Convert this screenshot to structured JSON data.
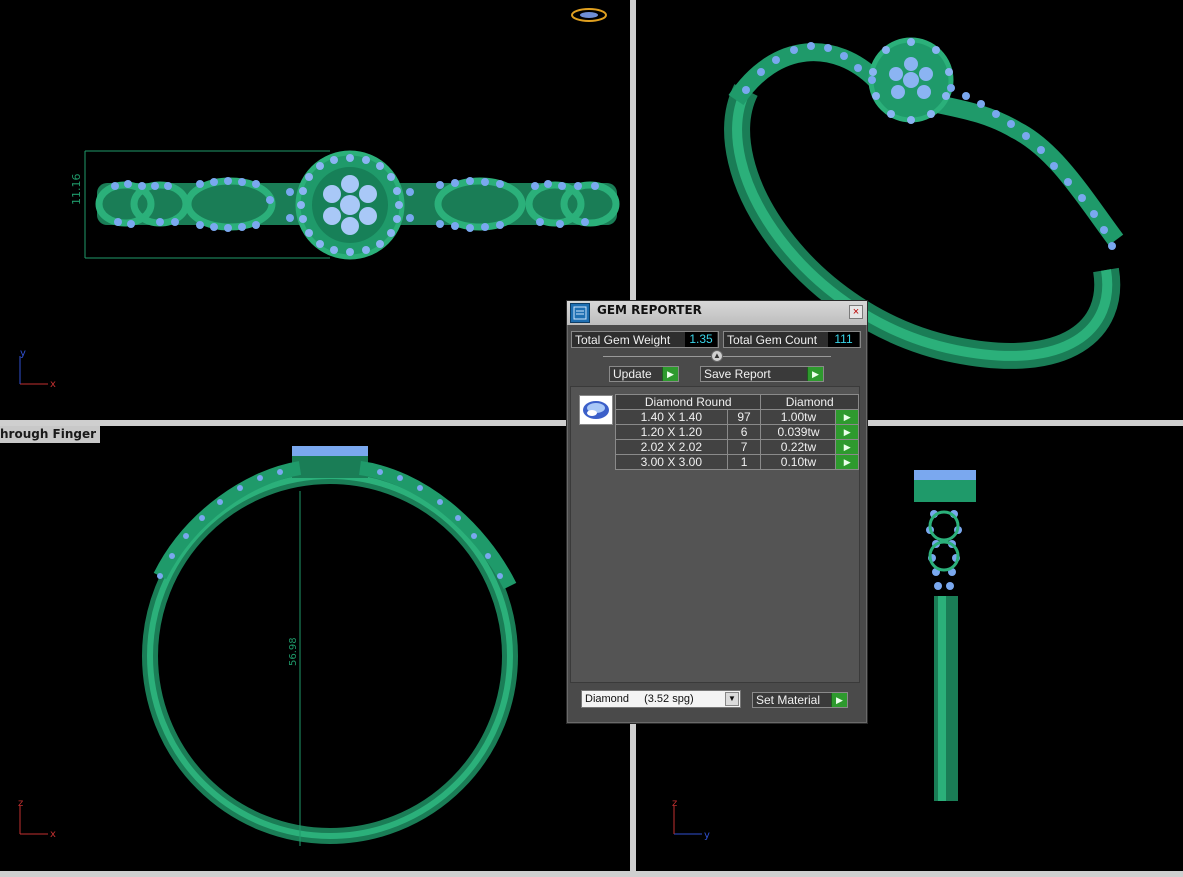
{
  "viewports": {
    "top_left": {
      "dimension": "11.16"
    },
    "bottom_left": {
      "label": "hrough Finger",
      "dimension": "56.98"
    },
    "axes": {
      "x": "x",
      "y": "y",
      "z": "z"
    }
  },
  "gem_reporter": {
    "title": "GEM REPORTER",
    "close": "×",
    "total_weight_label": "Total Gem Weight",
    "total_weight_value": "1.35",
    "total_count_label": "Total Gem Count",
    "total_count_value": "111",
    "update_label": "Update",
    "save_report_label": "Save Report",
    "table": {
      "headers": [
        "Diamond Round",
        "",
        "Diamond"
      ],
      "rows": [
        {
          "size": "1.40 X 1.40",
          "count": "97",
          "weight": "1.00tw"
        },
        {
          "size": "1.20 X 1.20",
          "count": "6",
          "weight": "0.039tw"
        },
        {
          "size": "2.02 X 2.02",
          "count": "7",
          "weight": "0.22tw"
        },
        {
          "size": "3.00 X 3.00",
          "count": "1",
          "weight": "0.10tw"
        }
      ]
    },
    "material_name": "Diamond",
    "material_sg": "(3.52 spg)",
    "set_material_label": "Set Material"
  },
  "colors": {
    "metal": "#1f9a6a",
    "metal_light": "#34c28a",
    "gem": "#7aa8ef",
    "value_text": "#39d4e8"
  }
}
